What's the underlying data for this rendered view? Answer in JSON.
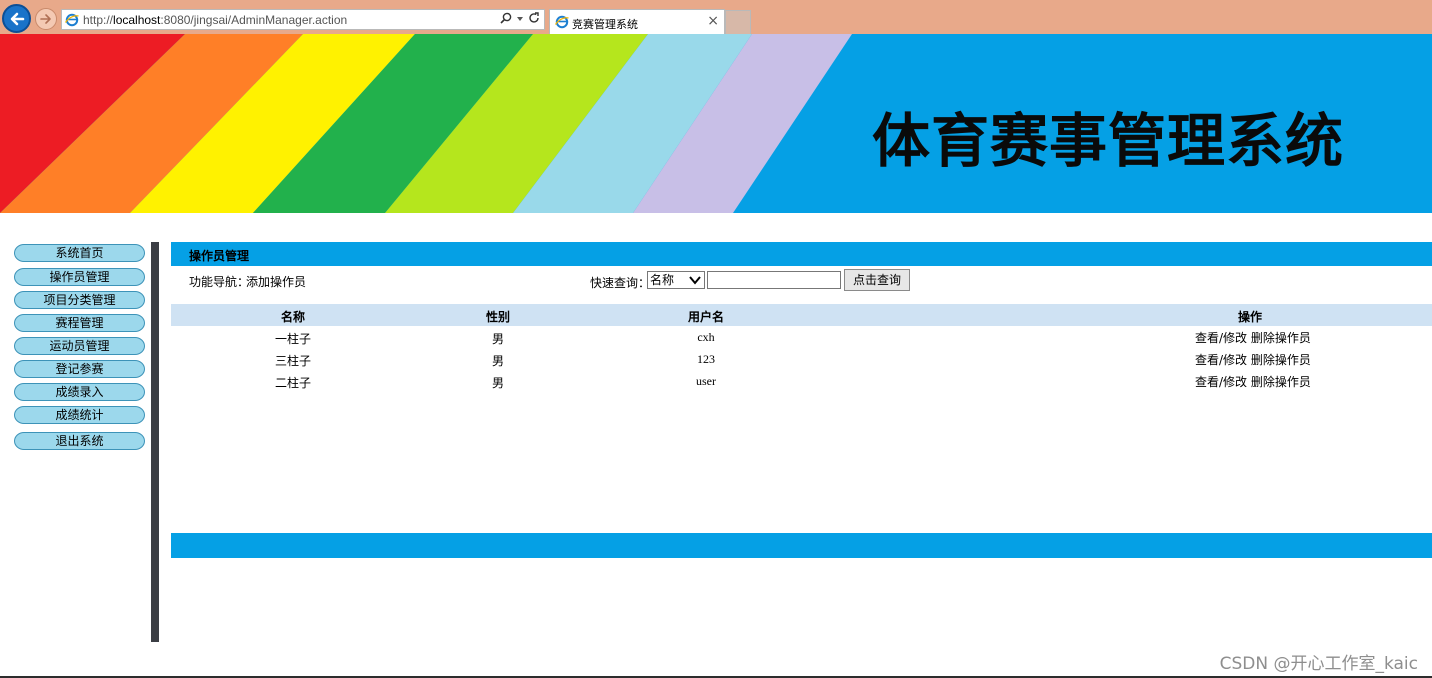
{
  "browser": {
    "url_prefix": "http://",
    "url_host": "localhost",
    "url_rest": ":8080/jingsai/AdminManager.action",
    "tab_title": "竞赛管理系统",
    "tab_close": "×"
  },
  "banner": {
    "title": "体育赛事管理系统",
    "stripe_colors": [
      "#ed1c24",
      "#ff7f27",
      "#fff200",
      "#22b14c",
      "#b5e61d",
      "#99d9ea",
      "#c8bfe7"
    ],
    "background_color": "#05a0e5"
  },
  "sidebar": {
    "items": [
      {
        "label": "系统首页"
      },
      {
        "label": "操作员管理"
      },
      {
        "label": "项目分类管理"
      },
      {
        "label": "赛程管理"
      },
      {
        "label": "运动员管理"
      },
      {
        "label": "登记参赛"
      },
      {
        "label": "成绩录入"
      },
      {
        "label": "成绩统计"
      },
      {
        "label": "退出系统"
      }
    ]
  },
  "panel": {
    "title": "操作员管理",
    "nav_label": "功能导航：",
    "nav_link": "添加操作员",
    "quick_label": "快速查询：",
    "quick_select_value": "名称",
    "quick_input_value": "",
    "quick_button": "点击查询"
  },
  "table": {
    "headers": [
      "名称",
      "性别",
      "用户名",
      "操作"
    ],
    "rows": [
      {
        "name": "一柱子",
        "gender": "男",
        "username": "cxh",
        "view_edit": "查看/修改",
        "delete": "删除操作员"
      },
      {
        "name": "三柱子",
        "gender": "男",
        "username": "123",
        "view_edit": "查看/修改",
        "delete": "删除操作员"
      },
      {
        "name": "二柱子",
        "gender": "男",
        "username": "user",
        "view_edit": "查看/修改",
        "delete": "删除操作员"
      }
    ]
  },
  "watermark": "CSDN @开心工作室_kaic"
}
